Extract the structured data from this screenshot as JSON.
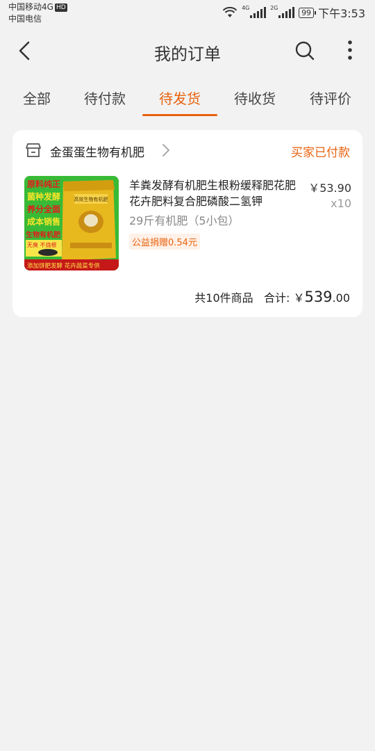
{
  "status_bar": {
    "carrier1": "中国移动4G",
    "hd_badge": "HD",
    "carrier2": "中国电信",
    "sig1_label": "4G",
    "sig2_label": "2G",
    "battery": "99",
    "time": "下午3:53"
  },
  "header": {
    "title": "我的订单",
    "icons": [
      "back-arrow-icon",
      "search-icon",
      "more-vertical-icon"
    ]
  },
  "tabs": [
    {
      "label": "全部"
    },
    {
      "label": "待付款"
    },
    {
      "label": "待发货",
      "active": true
    },
    {
      "label": "待收货"
    },
    {
      "label": "待评价"
    }
  ],
  "order": {
    "shop_name": "金蛋蛋生物有机肥",
    "status": "买家已付款",
    "product": {
      "title": "羊粪发酵有机肥生根粉缓释肥花肥花卉肥料复合肥磷酸二氢钾",
      "sku": "29斤有机肥（5小包）",
      "tag": "公益捐赠0.54元",
      "price": "￥53.90",
      "qty": "x10",
      "image_text": {
        "line1": "原料纯正",
        "line2": "菌种发酵",
        "line3": "养分全面",
        "line4": "成本销售",
        "line5": "生物有机肥",
        "badge": "无臭 不烧根",
        "bag_label": "高效生物有机肥",
        "banner": "添加饼肥发酵 花卉蔬菜专供"
      }
    },
    "summary": {
      "count_text": "共10件商品",
      "total_label": "合计:",
      "currency": "￥",
      "total_int": "539",
      "total_dec": ".00"
    }
  },
  "colors": {
    "accent": "#e8620e",
    "background": "#f2f2f2",
    "card": "#ffffff"
  }
}
